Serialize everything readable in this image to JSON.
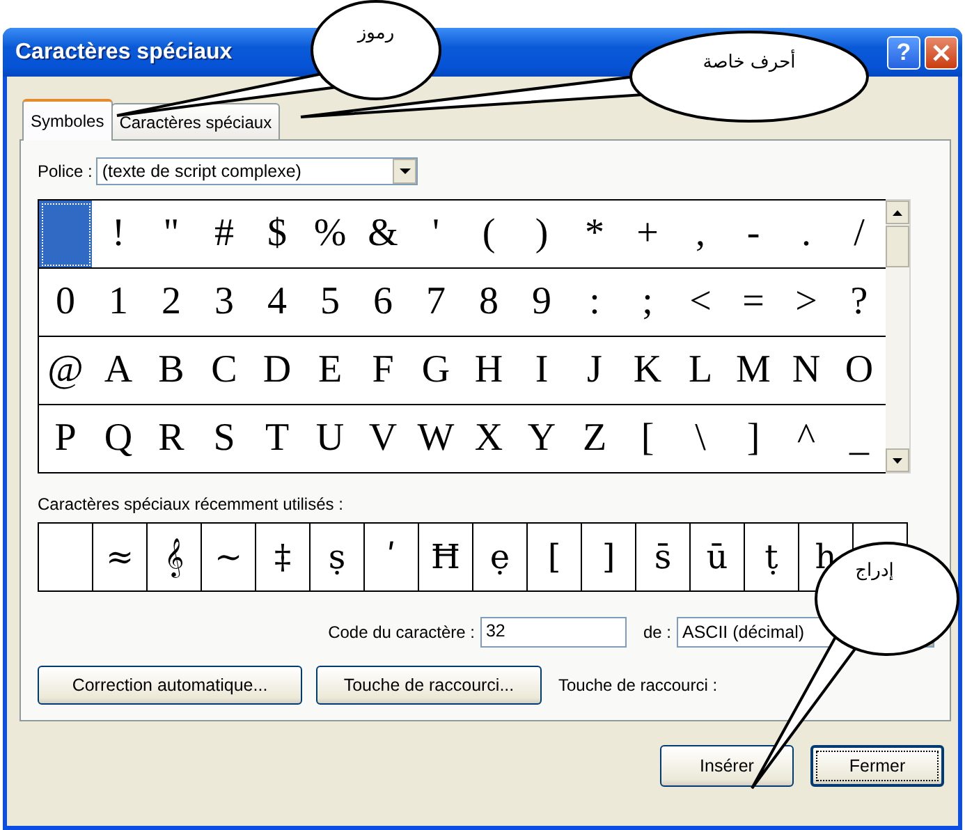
{
  "window": {
    "title": "Caractères spéciaux",
    "help_button": "?"
  },
  "tabs": [
    {
      "label": "Symboles",
      "selected": true
    },
    {
      "label": "Caractères spéciaux",
      "selected": false
    }
  ],
  "font": {
    "label": "Police :",
    "value": "(texte de script complexe)"
  },
  "symbols": [
    {
      "selected": true
    },
    {
      "char": "!",
      "selected": false
    },
    {
      "char": "\"",
      "selected": false
    },
    {
      "char": "#",
      "selected": false
    },
    {
      "char": "$",
      "selected": false
    },
    {
      "char": "%",
      "selected": false
    },
    {
      "char": "&",
      "selected": false
    },
    {
      "char": "'",
      "selected": false
    },
    {
      "char": "(",
      "selected": false
    },
    {
      "char": ")",
      "selected": false
    },
    {
      "char": "*",
      "selected": false
    },
    {
      "char": "+",
      "selected": false
    },
    {
      "char": ",",
      "selected": false
    },
    {
      "char": "-",
      "selected": false
    },
    {
      "char": ".",
      "selected": false
    },
    {
      "char": "/",
      "selected": false
    },
    {
      "char": "0",
      "selected": false
    },
    {
      "char": "1",
      "selected": false
    },
    {
      "char": "2",
      "selected": false
    },
    {
      "char": "3",
      "selected": false
    },
    {
      "char": "4",
      "selected": false
    },
    {
      "char": "5",
      "selected": false
    },
    {
      "char": "6",
      "selected": false
    },
    {
      "char": "7",
      "selected": false
    },
    {
      "char": "8",
      "selected": false
    },
    {
      "char": "9",
      "selected": false
    },
    {
      "char": ":",
      "selected": false
    },
    {
      "char": ";",
      "selected": false
    },
    {
      "char": "<",
      "selected": false
    },
    {
      "char": "=",
      "selected": false
    },
    {
      "char": ">",
      "selected": false
    },
    {
      "char": "?",
      "selected": false
    },
    {
      "char": "@",
      "selected": false
    },
    {
      "char": "A",
      "selected": false
    },
    {
      "char": "B",
      "selected": false
    },
    {
      "char": "C",
      "selected": false
    },
    {
      "char": "D",
      "selected": false
    },
    {
      "char": "E",
      "selected": false
    },
    {
      "char": "F",
      "selected": false
    },
    {
      "char": "G",
      "selected": false
    },
    {
      "char": "H",
      "selected": false
    },
    {
      "char": "I",
      "selected": false
    },
    {
      "char": "J",
      "selected": false
    },
    {
      "char": "K",
      "selected": false
    },
    {
      "char": "L",
      "selected": false
    },
    {
      "char": "M",
      "selected": false
    },
    {
      "char": "N",
      "selected": false
    },
    {
      "char": "O",
      "selected": false
    },
    {
      "char": "P",
      "selected": false
    },
    {
      "char": "Q",
      "selected": false
    },
    {
      "char": "R",
      "selected": false
    },
    {
      "char": "S",
      "selected": false
    },
    {
      "char": "T",
      "selected": false
    },
    {
      "char": "U",
      "selected": false
    },
    {
      "char": "V",
      "selected": false
    },
    {
      "char": "W",
      "selected": false
    },
    {
      "char": "X",
      "selected": false
    },
    {
      "char": "Y",
      "selected": false
    },
    {
      "char": "Z",
      "selected": false
    },
    {
      "char": "[",
      "selected": false
    },
    {
      "char": "\\",
      "selected": false
    },
    {
      "char": "]",
      "selected": false
    },
    {
      "char": "^",
      "selected": false
    },
    {
      "char": "_",
      "selected": false
    }
  ],
  "recent": {
    "label": "Caractères spéciaux récemment utilisés :",
    "cells": [
      {
        "kind": "blank"
      },
      {
        "kind": "char",
        "char": "≈"
      },
      {
        "kind": "char",
        "char": "𝄞"
      },
      {
        "kind": "char",
        "char": "~"
      },
      {
        "kind": "char",
        "char": "‡"
      },
      {
        "kind": "char",
        "char": "ṣ"
      },
      {
        "kind": "char",
        "char": "ʹ"
      },
      {
        "kind": "char",
        "char": "Ħ"
      },
      {
        "kind": "char",
        "char": "ẹ"
      },
      {
        "kind": "char",
        "char": "["
      },
      {
        "kind": "char",
        "char": "]"
      },
      {
        "kind": "char",
        "char": "s̄"
      },
      {
        "kind": "char",
        "char": "ū"
      },
      {
        "kind": "char",
        "char": "ṭ"
      },
      {
        "kind": "char",
        "char": "h"
      },
      {
        "kind": "blank"
      }
    ]
  },
  "char_code": {
    "label": "Code du caractère :",
    "value": "32"
  },
  "from": {
    "label": "de :",
    "value": "ASCII (décimal)"
  },
  "buttons": [
    {
      "label": "Correction automatique..."
    },
    {
      "label": "Touche de raccourci..."
    }
  ],
  "shortcut_label": "Touche de raccourci :",
  "footer_buttons": [
    {
      "label": "Insérer",
      "default": false
    },
    {
      "label": "Fermer",
      "default": true
    }
  ],
  "callouts": [
    {
      "text": "رموز"
    },
    {
      "text": "أحرف خاصة"
    },
    {
      "text": "إدراج"
    }
  ]
}
